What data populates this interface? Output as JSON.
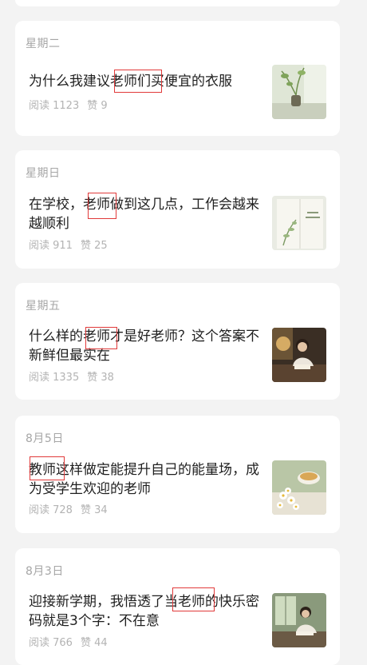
{
  "articles": [
    {
      "date": "星期二",
      "title": "为什么我建议老师们买便宜的衣服",
      "read_label": "阅读 1123",
      "like_label": "赞 9",
      "thumb_icon": "plant-vase-thumbnail"
    },
    {
      "date": "星期日",
      "title": "在学校，老师做到这几点，工作会越来越顺利",
      "read_label": "阅读 911",
      "like_label": "赞 25",
      "thumb_icon": "notebook-leaf-thumbnail"
    },
    {
      "date": "星期五",
      "title": "什么样的老师才是好老师？这个答案不新鲜但最实在",
      "read_label": "阅读 1335",
      "like_label": "赞 38",
      "thumb_icon": "woman-reading-desk-thumbnail"
    },
    {
      "date": "8月5日",
      "title": "教师这样做定能提升自己的能量场，成为受学生欢迎的老师",
      "read_label": "阅读 728",
      "like_label": "赞 34",
      "thumb_icon": "tea-flowers-thumbnail"
    },
    {
      "date": "8月3日",
      "title": "迎接新学期，我悟透了当老师的快乐密码就是3个字：不在意",
      "read_label": "阅读 766",
      "like_label": "赞 44",
      "thumb_icon": "woman-window-desk-thumbnail"
    }
  ],
  "colors": {
    "background": "#f3f3f3",
    "card": "#ffffff",
    "highlight_box": "#e13a3a"
  }
}
